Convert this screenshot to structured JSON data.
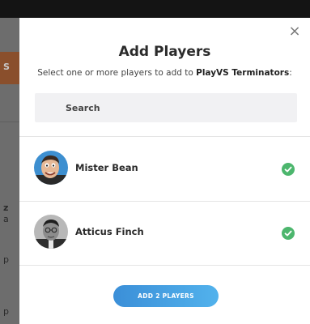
{
  "modal": {
    "title": "Add Players",
    "subtitle_prefix": "Select one or more players to add to ",
    "team_name": "PlayVS Terminators",
    "subtitle_suffix": ":",
    "close_glyph": "×",
    "search_placeholder": "Search",
    "players": [
      {
        "name": "Mister Bean",
        "selected": true
      },
      {
        "name": "Atticus Finch",
        "selected": true
      }
    ],
    "add_button_label": "ADD 2 PLAYERS"
  },
  "colors": {
    "accent_blue": "#3b8fd8",
    "check_green": "#4cb66d"
  },
  "background": {
    "fragments": [
      "S",
      "z",
      "a",
      "p",
      "p"
    ]
  }
}
